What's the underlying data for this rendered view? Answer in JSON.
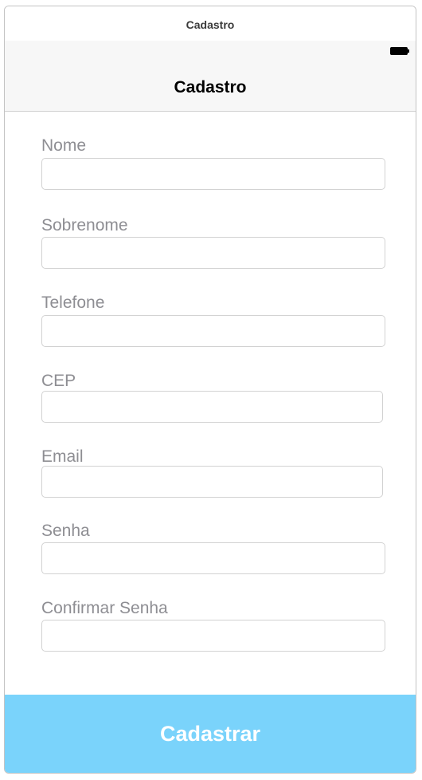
{
  "scene": {
    "title": "Cadastro"
  },
  "nav": {
    "title": "Cadastro",
    "battery_icon": "battery-icon"
  },
  "form": {
    "fields": [
      {
        "label": "Nome",
        "value": "",
        "placeholder": ""
      },
      {
        "label": "Sobrenome",
        "value": "",
        "placeholder": ""
      },
      {
        "label": "Telefone",
        "value": "",
        "placeholder": ""
      },
      {
        "label": "CEP",
        "value": "",
        "placeholder": ""
      },
      {
        "label": "Email",
        "value": "",
        "placeholder": ""
      },
      {
        "label": "Senha",
        "value": "",
        "placeholder": ""
      },
      {
        "label": "Confirmar Senha",
        "value": "",
        "placeholder": ""
      }
    ]
  },
  "submit": {
    "label": "Cadastrar",
    "color": "#7ad3fb"
  },
  "colors": {
    "label_text": "#8e8e93",
    "nav_background": "#f7f7f7",
    "field_border": "#d2d2d2"
  }
}
